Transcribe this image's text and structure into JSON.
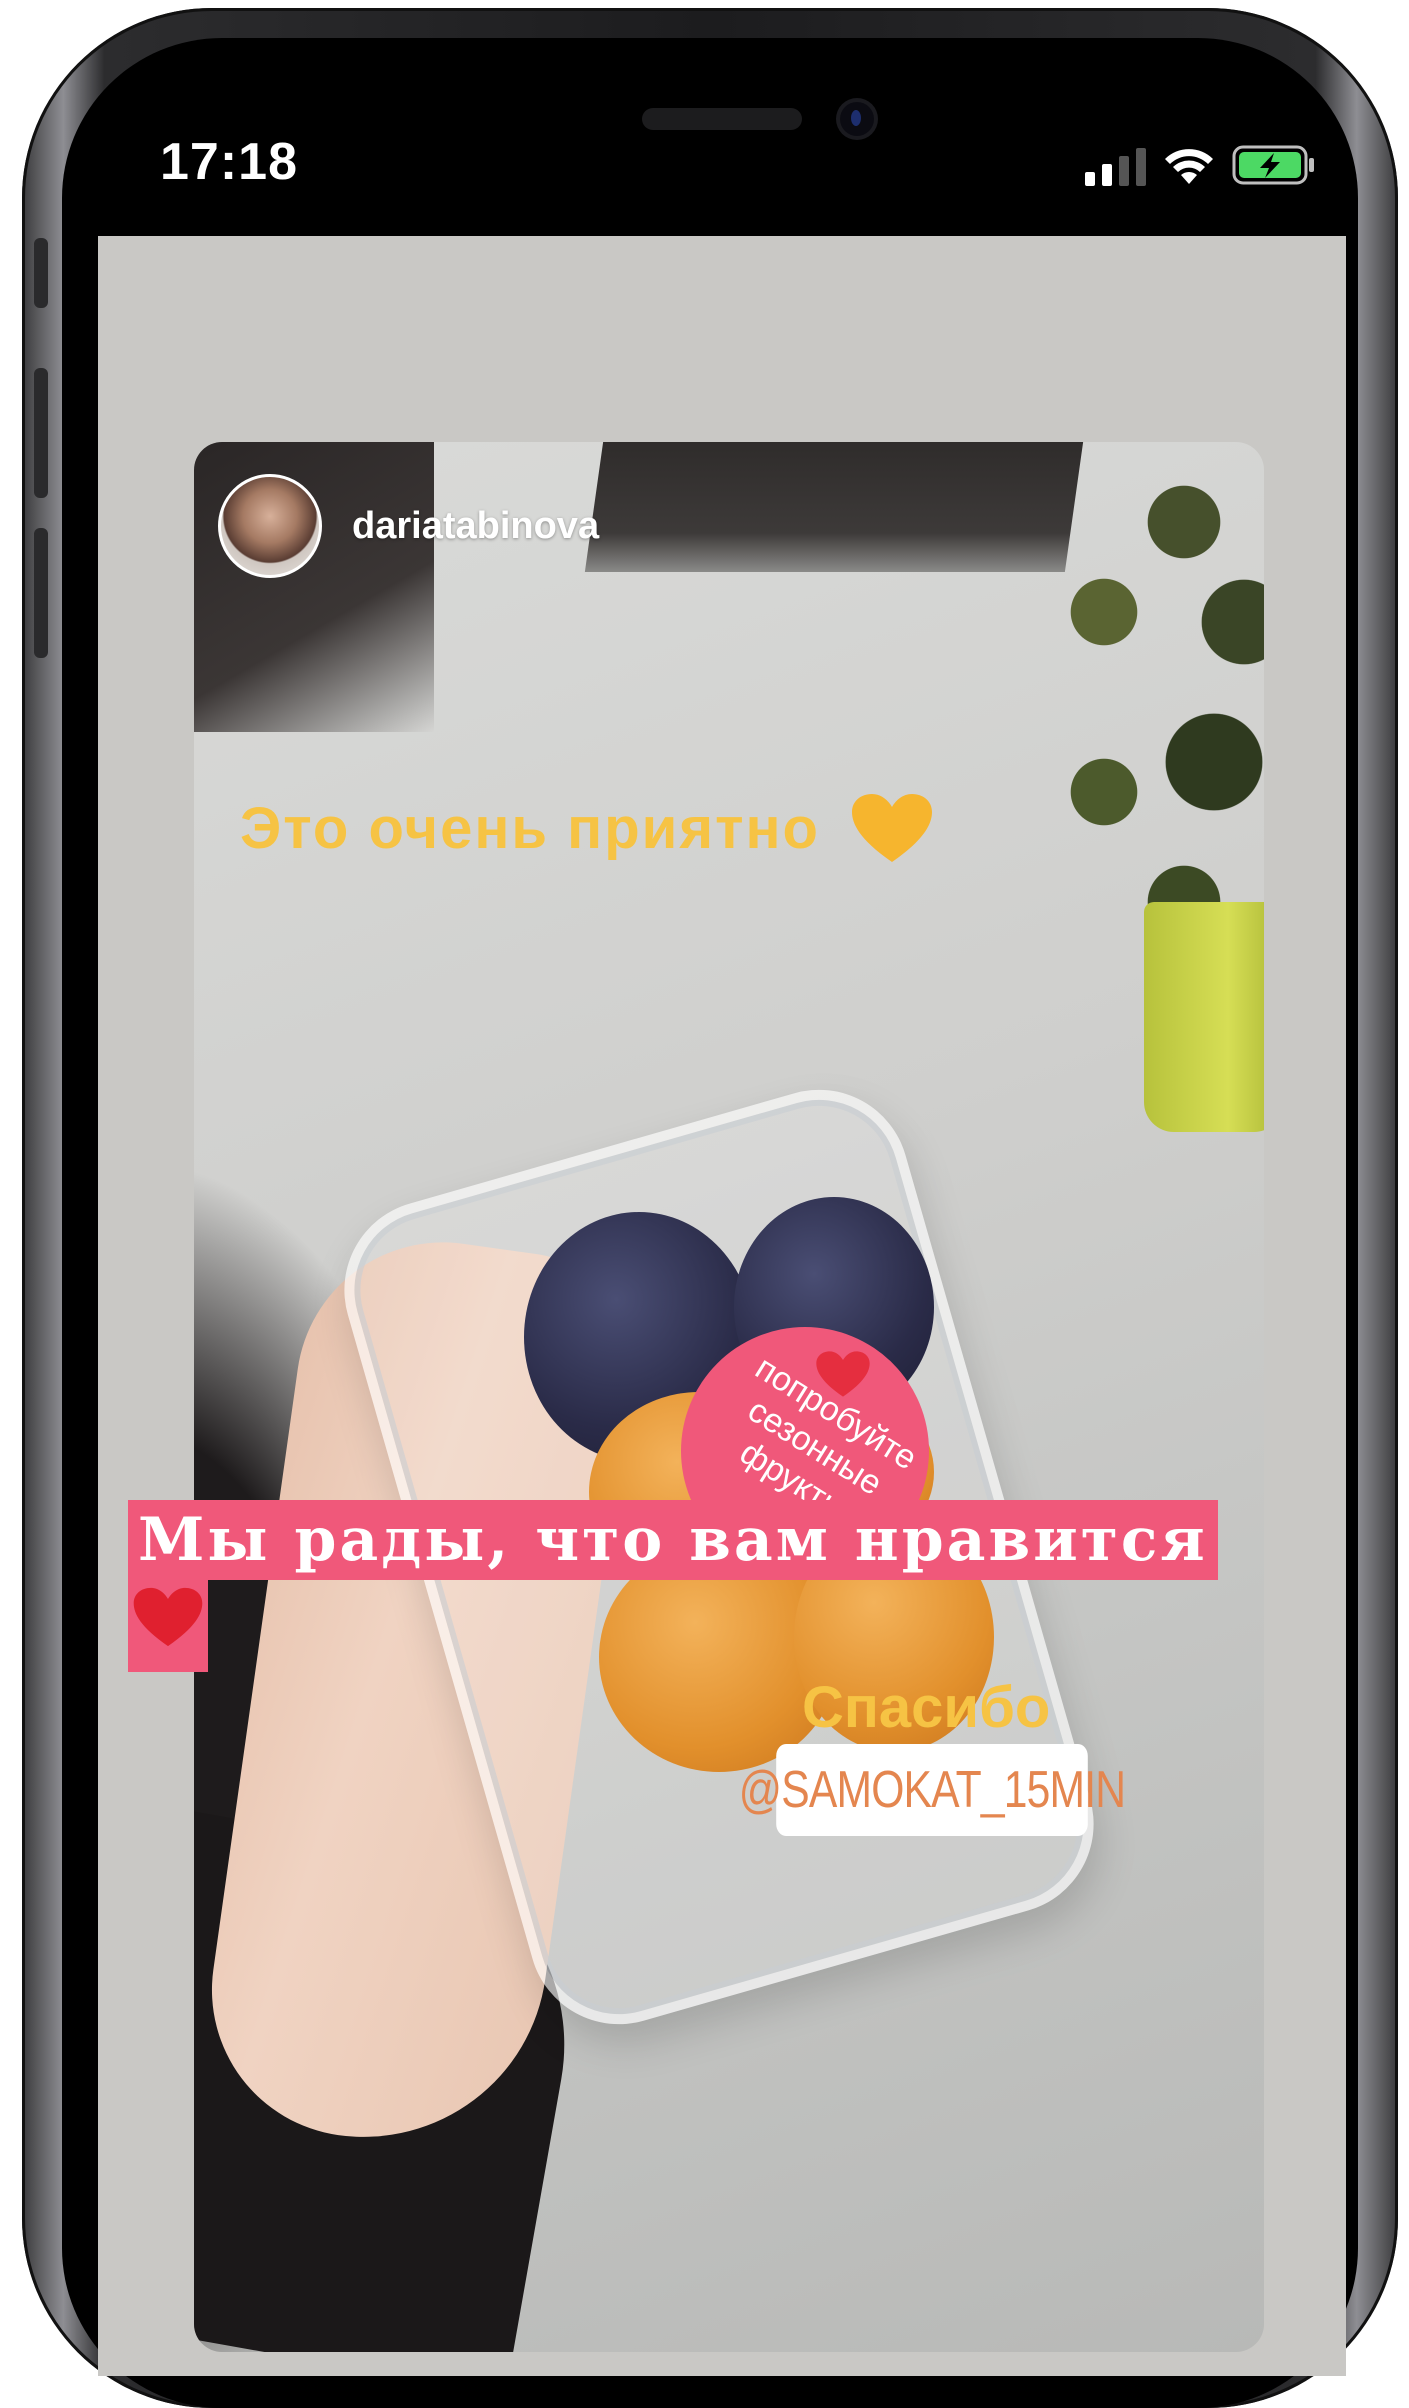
{
  "status_bar": {
    "time": "17:18",
    "icons": [
      "signal-icon",
      "wifi-icon",
      "battery-charging-icon"
    ],
    "battery_color": "#4cd964"
  },
  "story": {
    "username": "dariatabinova",
    "caption_top": "Это очень приятно",
    "sticker_lines": [
      "попробуйте",
      "сезонные",
      "фрукты"
    ],
    "thanks": "Спасибо",
    "mention": "@SAMOKAT_15MIN",
    "bottom_caption": "Мы рады, что вам нравится"
  },
  "colors": {
    "accent_yellow": "#f6c344",
    "accent_pink": "#f0587a",
    "mention_orange": "#e4864f"
  }
}
